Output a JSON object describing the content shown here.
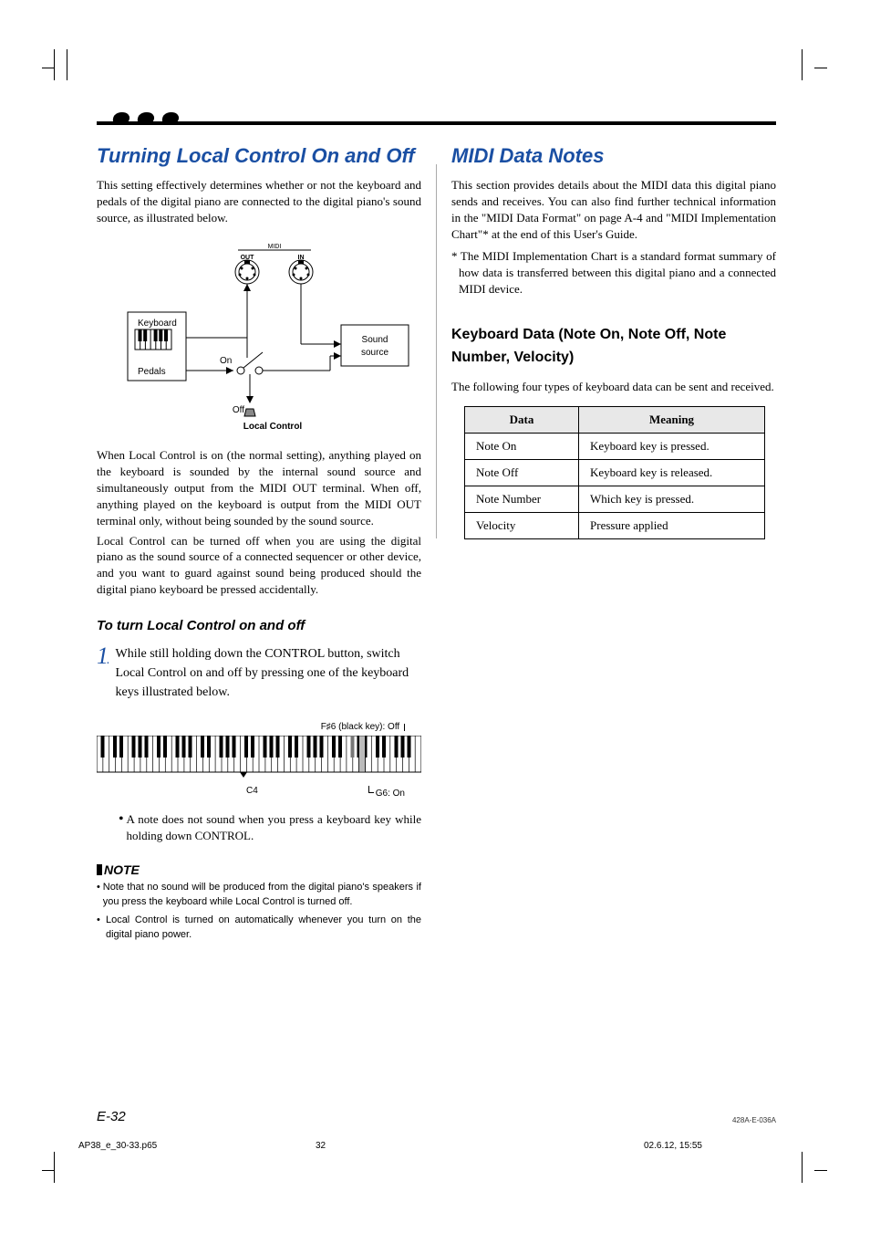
{
  "left": {
    "h2": "Turning Local Control On and Off",
    "p1": "This setting effectively determines whether or not the keyboard and pedals of the digital piano are connected to the digital piano's sound source, as illustrated below.",
    "diagram": {
      "midi": "MIDI",
      "out": "OUT",
      "in": "IN",
      "keyboard": "Keyboard",
      "pedals": "Pedals",
      "sound_source_l1": "Sound",
      "sound_source_l2": "source",
      "on": "On",
      "off": "Off",
      "caption": "Local Control"
    },
    "p2": "When Local Control is on (the normal setting), anything played on the keyboard is sounded by the internal sound source and simultaneously output from the MIDI OUT terminal.  When off, anything played on the keyboard is output from the MIDI OUT terminal only, without being sounded by the sound source.",
    "p3": "Local Control can be turned off when you are using the digital piano as the sound source of a connected sequencer or other device, and you want to guard against sound being produced should the digital piano keyboard be pressed accidentally.",
    "sub": "To turn Local Control on and off",
    "step1": "While still holding down the CONTROL button, switch Local Control on and off by pressing one of the keyboard keys illustrated below.",
    "kbd_top": "F♯6 (black key): Off",
    "kbd_c4": "C4",
    "kbd_g6": "G6: On",
    "bullet": "A note does not sound when you press a keyboard key while holding down CONTROL.",
    "note_h": "NOTE",
    "note1": "Note that no sound will be produced from the digital piano's speakers if you press the keyboard while Local Control is turned off.",
    "note2": "Local Control is turned on automatically whenever you turn on the digital piano power."
  },
  "right": {
    "h2": "MIDI Data Notes",
    "p1": "This section provides details about the MIDI data this digital piano sends and receives. You can also find further technical information in the \"MIDI Data Format\" on page A-4 and \"MIDI Implementation Chart\"* at the end of this User's Guide.",
    "foot": "* The MIDI Implementation Chart is a standard format summary of how data is transferred between this digital piano and a connected MIDI device.",
    "h3": "Keyboard Data (Note On, Note Off, Note Number, Velocity)",
    "p2": "The following four types of keyboard data can be sent and received.",
    "table": {
      "h1": "Data",
      "h2": "Meaning",
      "rows": [
        {
          "d": "Note On",
          "m": "Keyboard  key is pressed."
        },
        {
          "d": "Note Off",
          "m": "Keyboard key is released."
        },
        {
          "d": "Note Number",
          "m": "Which key is pressed."
        },
        {
          "d": "Velocity",
          "m": "Pressure applied"
        }
      ]
    }
  },
  "footer": {
    "page": "E-32",
    "docid": "428A-E-036A"
  },
  "srcfoot": {
    "a": "AP38_e_30-33.p65",
    "b": "32",
    "c": "02.6.12, 15:55"
  }
}
